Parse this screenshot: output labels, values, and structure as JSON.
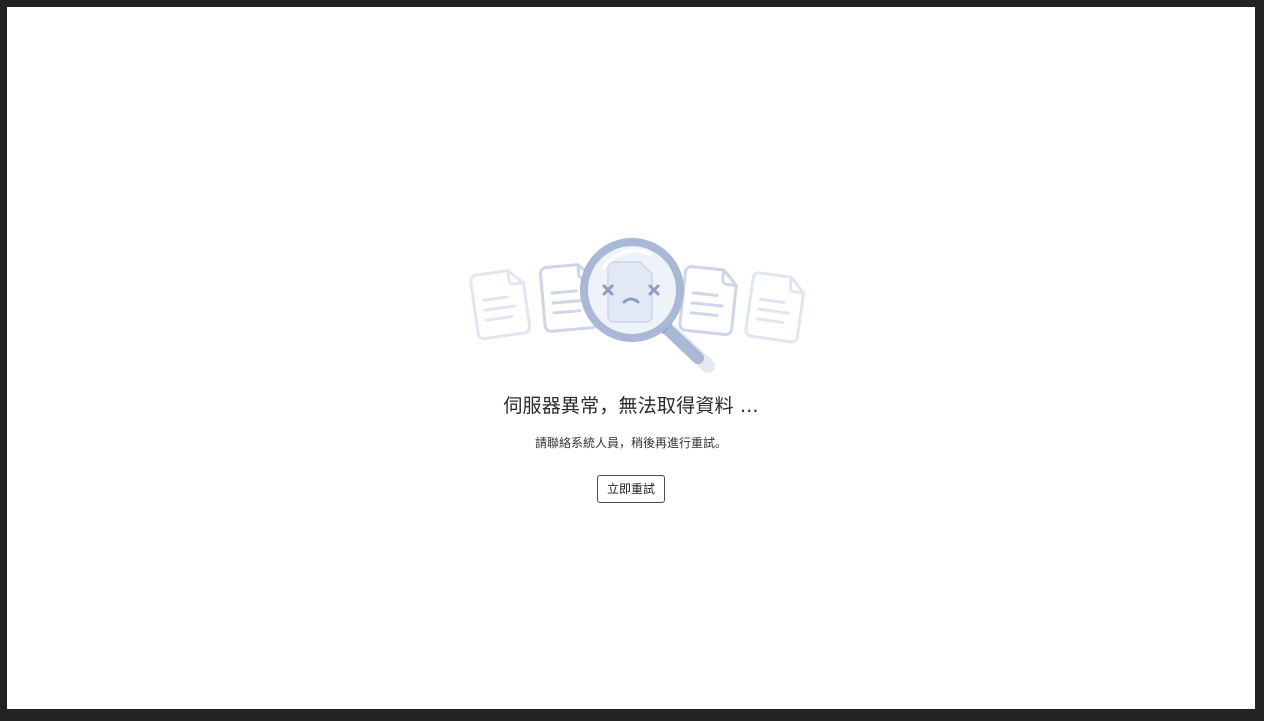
{
  "error": {
    "title": "伺服器異常，無法取得資料 ...",
    "message": "請聯絡系統人員，稍後再進行重試。",
    "retry_label": "立即重試",
    "illustration_icon": "magnifier-with-documents-icon"
  },
  "colors": {
    "background": "#ffffff",
    "frame": "#232323",
    "illustration_primary": "#a8b8d6",
    "illustration_light": "#e4e9f3",
    "text": "#2b2b2b"
  }
}
